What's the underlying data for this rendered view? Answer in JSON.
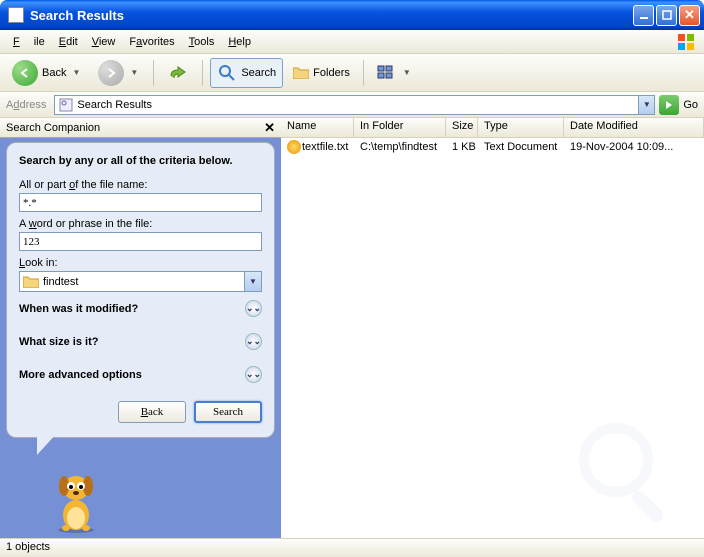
{
  "window": {
    "title": "Search Results"
  },
  "menu": {
    "file": "File",
    "edit": "Edit",
    "view": "View",
    "favorites": "Favorites",
    "tools": "Tools",
    "help": "Help"
  },
  "toolbar": {
    "back": "Back",
    "search": "Search",
    "folders": "Folders"
  },
  "address": {
    "label": "Address",
    "value": "Search Results",
    "go": "Go"
  },
  "companion": {
    "title": "Search Companion",
    "heading": "Search by any or all of the criteria below.",
    "filename_label": "All or part of the file name:",
    "filename_value": "*.*",
    "phrase_label": "A word or phrase in the file:",
    "phrase_value": "123",
    "lookin_label": "Look in:",
    "lookin_value": "findtest",
    "when_modified": "When was it modified?",
    "what_size": "What size is it?",
    "more_options": "More advanced options",
    "back_btn": "Back",
    "search_btn": "Search"
  },
  "columns": {
    "name": "Name",
    "folder": "In Folder",
    "size": "Size",
    "type": "Type",
    "date": "Date Modified"
  },
  "results": {
    "rows": [
      {
        "name": "textfile.txt",
        "folder": "C:\\temp\\findtest",
        "size": "1 KB",
        "type": "Text Document",
        "date": "19-Nov-2004 10:09..."
      }
    ]
  },
  "status": {
    "text": "1 objects"
  }
}
